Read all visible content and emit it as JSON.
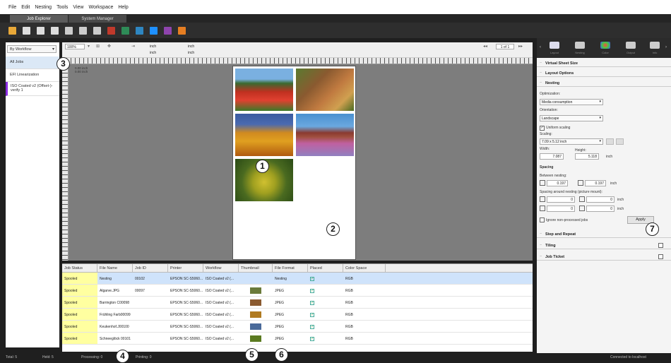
{
  "menu": [
    "File",
    "Edit",
    "Nesting",
    "Tools",
    "View",
    "Workspace",
    "Help"
  ],
  "tabs": [
    {
      "label": "Job Explorer"
    },
    {
      "label": "System Manager"
    }
  ],
  "toolbar": {
    "icon_colors": [
      "#e8a838",
      "#ddd",
      "#ddd",
      "#ddd",
      "#ccc",
      "#ccc",
      "#ccc",
      "#c0392b",
      "#2e8b57",
      "#2e86c1",
      "#1e90ff",
      "#8e44ad",
      "#e67e22"
    ]
  },
  "left": {
    "workflow_select": "By Workflow",
    "items": [
      {
        "label": "All Jobs"
      },
      {
        "label": "EFI Linearization"
      },
      {
        "label": "ISO Coated v2 (Offset-)-verify 1"
      }
    ]
  },
  "center_toolbar": {
    "zoom": "100%",
    "unit1": "inch",
    "unit2": "inch",
    "unit3": "inch",
    "unit4": "inch",
    "page": "1 of 1"
  },
  "canvas": {
    "info": "0.00 inch\n0.00 inch"
  },
  "joblist": {
    "columns": [
      "Job Status",
      "File Name",
      "Job ID",
      "Printer",
      "Workflow",
      "Thumbnail",
      "File Format",
      "Placed",
      "Color Space"
    ],
    "rows": [
      {
        "status": "Spooled",
        "file": "Nesting",
        "id": "00102",
        "printer": "EPSON SC-S5060...",
        "workflow": "ISO Coated v2 (...",
        "format": "Nesting",
        "color": "RGB",
        "thumb": ""
      },
      {
        "status": "Spooled",
        "file": "Algarve.JPG",
        "id": "00097",
        "printer": "EPSON SC-S5060...",
        "workflow": "ISO Coated v2 (...",
        "format": "JPEG",
        "color": "RGB",
        "thumb": "#6a7a3a"
      },
      {
        "status": "Spooled",
        "file": "Barrington C00098",
        "id": "",
        "printer": "EPSON SC-S5060...",
        "workflow": "ISO Coated v2 (...",
        "format": "JPEG",
        "color": "RGB",
        "thumb": "#8a5a30"
      },
      {
        "status": "Spooled",
        "file": "Frühling Farb00099",
        "id": "",
        "printer": "EPSON SC-S5060...",
        "workflow": "ISO Coated v2 (...",
        "format": "JPEG",
        "color": "RGB",
        "thumb": "#b07a20"
      },
      {
        "status": "Spooled",
        "file": "Keukenhof.J00100",
        "id": "",
        "printer": "EPSON SC-S5060...",
        "workflow": "ISO Coated v2 (...",
        "format": "JPEG",
        "color": "RGB",
        "thumb": "#4a6a9a"
      },
      {
        "status": "Spooled",
        "file": "Schneeglöck 00101",
        "id": "",
        "printer": "EPSON SC-S5060...",
        "workflow": "ISO Coated v2 (...",
        "format": "JPEG",
        "color": "RGB",
        "thumb": "#5a7a20"
      }
    ]
  },
  "statusbar": {
    "total": "Total: 5",
    "held": "Held: 5",
    "processing": "Processing: 0",
    "printing": "Printing: 0",
    "connection": "Connected to localhost"
  },
  "right": {
    "icons": [
      "Layout",
      "Nesting",
      "Color",
      "Output",
      "Info"
    ],
    "sections": {
      "virtual_sheet": "Virtual Sheet Size",
      "layout_options": "Layout Options",
      "nesting": "Nesting",
      "step_repeat": "Step and Repeat",
      "tiling": "Tiling",
      "job_ticket": "Job Ticket"
    },
    "optimization_label": "Optimization:",
    "optimization_value": "Media consumption",
    "orientation_label": "Orientation:",
    "orientation_value": "Landscape",
    "uniform_scaling": "Uniform scaling",
    "scaling_label": "Scaling:",
    "scaling_value": "7.09 x 5.12 inch",
    "width_label": "Width:",
    "width_value": "7.087",
    "height_label": "Height:",
    "height_value": "5.118",
    "unit": "inch",
    "spacing": "Spacing",
    "between_nesting": "Between nesting:",
    "between_a": "0.197",
    "between_b": "0.197",
    "around_label": "Spacing around nesting (picture mount):",
    "around_values": [
      "0",
      "0",
      "0",
      "0"
    ],
    "ignore": "Ignore non-processed jobs",
    "apply": "Apply"
  },
  "callouts": [
    "1",
    "2",
    "3",
    "4",
    "5",
    "6",
    "7"
  ]
}
